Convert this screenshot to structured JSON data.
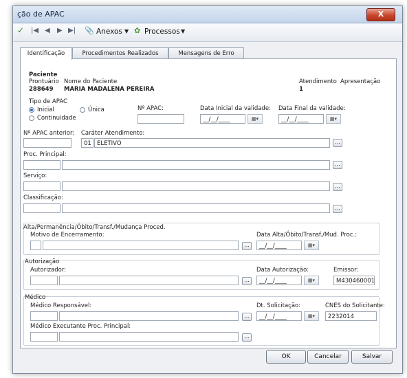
{
  "window": {
    "title": "ção de APAC",
    "close_label": "X"
  },
  "toolbar": {
    "anexos": "Anexos",
    "processos": "Processos"
  },
  "tabs": [
    "Identificação",
    "Procedimentos Realizados",
    "Mensagens de Erro"
  ],
  "paciente": {
    "section": "Paciente",
    "prontuario_label": "Prontuário",
    "prontuario": "288649",
    "nome_label": "Nome do Paciente",
    "nome": "MARIA MADALENA PEREIRA",
    "atendimento_label": "Atendimento",
    "apresentacao_label": "Apresentação",
    "apresentacao": "1"
  },
  "tipo": {
    "label": "Tipo de APAC",
    "inicial": "Inicial",
    "unica": "Única",
    "continuidade": "Continuidade"
  },
  "apac": {
    "numero_label": "Nº APAC:",
    "data_inicial_label": "Data Inicial da validade:",
    "data_final_label": "Data Final da validade:",
    "date_placeholder": "__/__/____",
    "anterior_label": "Nº APAC anterior:",
    "carater_label": "Caráter Atendimento:",
    "carater_code": "01",
    "carater_value": "ELETIVO",
    "proc_principal_label": "Proc. Principal:",
    "servico_label": "Serviço:",
    "classificacao_label": "Classificação:"
  },
  "alta": {
    "title": "Alta/Permanência/Óbito/Transf./Mudança Proced.",
    "motivo_label": "Motivo de Encerramento:",
    "data_label": "Data Alta/Óbito/Transf./Mud. Proc.:"
  },
  "autorizacao": {
    "title": "Autorização",
    "autorizador_label": "Autorizador:",
    "data_label": "Data Autorização:",
    "emissor_label": "Emissor:",
    "emissor": "M430460001"
  },
  "medico": {
    "title": "Médico",
    "responsavel_label": "Médico Responsável:",
    "solicitacao_label": "Dt. Solicitação:",
    "cnes_label": "CNES do Solicitante:",
    "cnes": "2232014",
    "executante_label": "Médico Executante Proc. Principal:"
  },
  "buttons": {
    "ok": "OK",
    "cancelar": "Cancelar",
    "salvar": "Salvar"
  },
  "ellipsis": "..."
}
